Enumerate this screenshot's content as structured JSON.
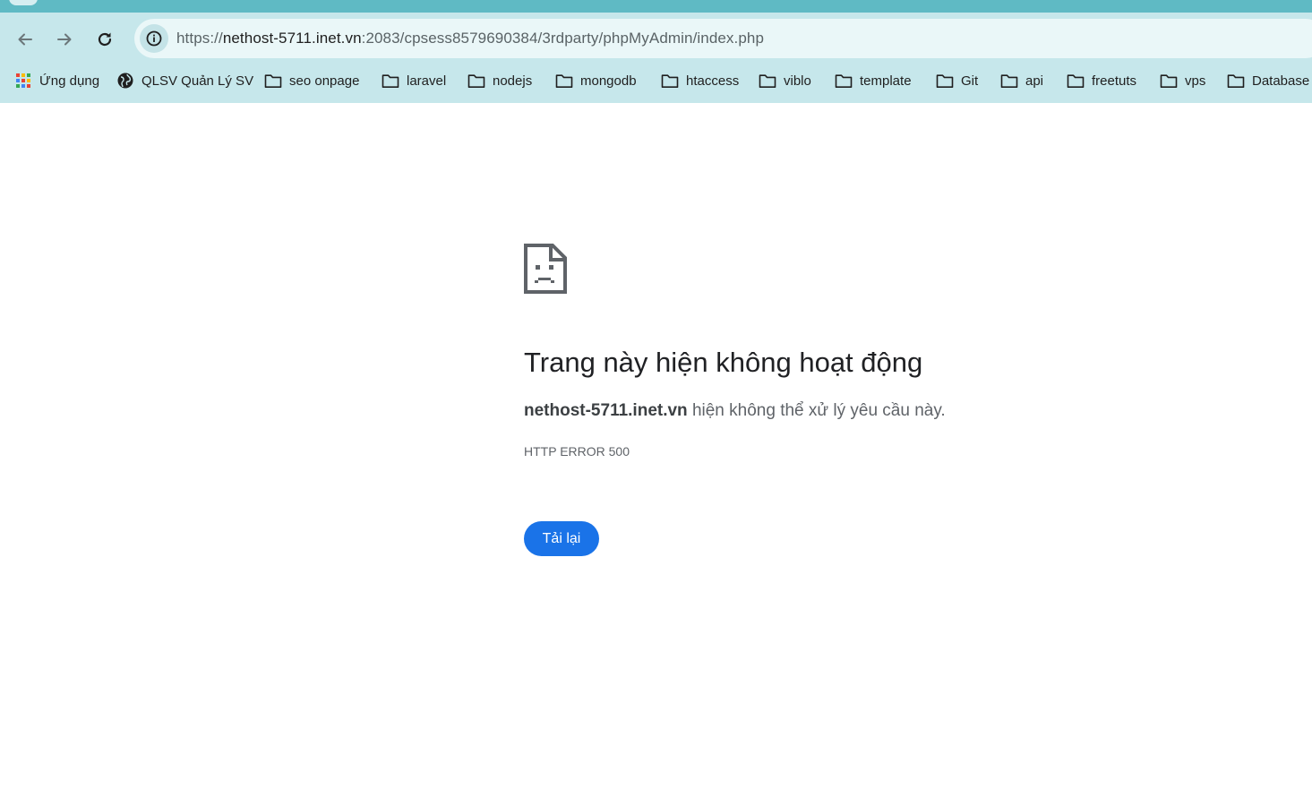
{
  "browser": {
    "url_scheme": "https://",
    "url_host": "nethost-5711.inet.vn",
    "url_rest": ":2083/cpsess8579690384/3rdparty/phpMyAdmin/index.php",
    "accent_color": "#5fbac4",
    "toolbar_color": "#c6e7eb"
  },
  "bookmarks": {
    "items": [
      {
        "label": "Ứng dụng",
        "icon": "apps-grid-icon"
      },
      {
        "label": "QLSV Quản Lý SV",
        "icon": "globe-icon"
      },
      {
        "label": "seo onpage",
        "icon": "folder-icon"
      },
      {
        "label": "laravel",
        "icon": "folder-icon"
      },
      {
        "label": "nodejs",
        "icon": "folder-icon"
      },
      {
        "label": "mongodb",
        "icon": "folder-icon"
      },
      {
        "label": "htaccess",
        "icon": "folder-icon"
      },
      {
        "label": "viblo",
        "icon": "folder-icon"
      },
      {
        "label": "template",
        "icon": "folder-icon"
      },
      {
        "label": "Git",
        "icon": "folder-icon"
      },
      {
        "label": "api",
        "icon": "folder-icon"
      },
      {
        "label": "freetuts",
        "icon": "folder-icon"
      },
      {
        "label": "vps",
        "icon": "folder-icon"
      },
      {
        "label": "Database",
        "icon": "folder-icon"
      }
    ]
  },
  "error_page": {
    "icon": "sad-page-icon",
    "title": "Trang này hiện không hoạt động",
    "host": "nethost-5711.inet.vn",
    "message": " hiện không thể xử lý yêu cầu này.",
    "error_code": "HTTP ERROR 500",
    "reload_label": "Tải lại",
    "button_color": "#1a73e8"
  }
}
